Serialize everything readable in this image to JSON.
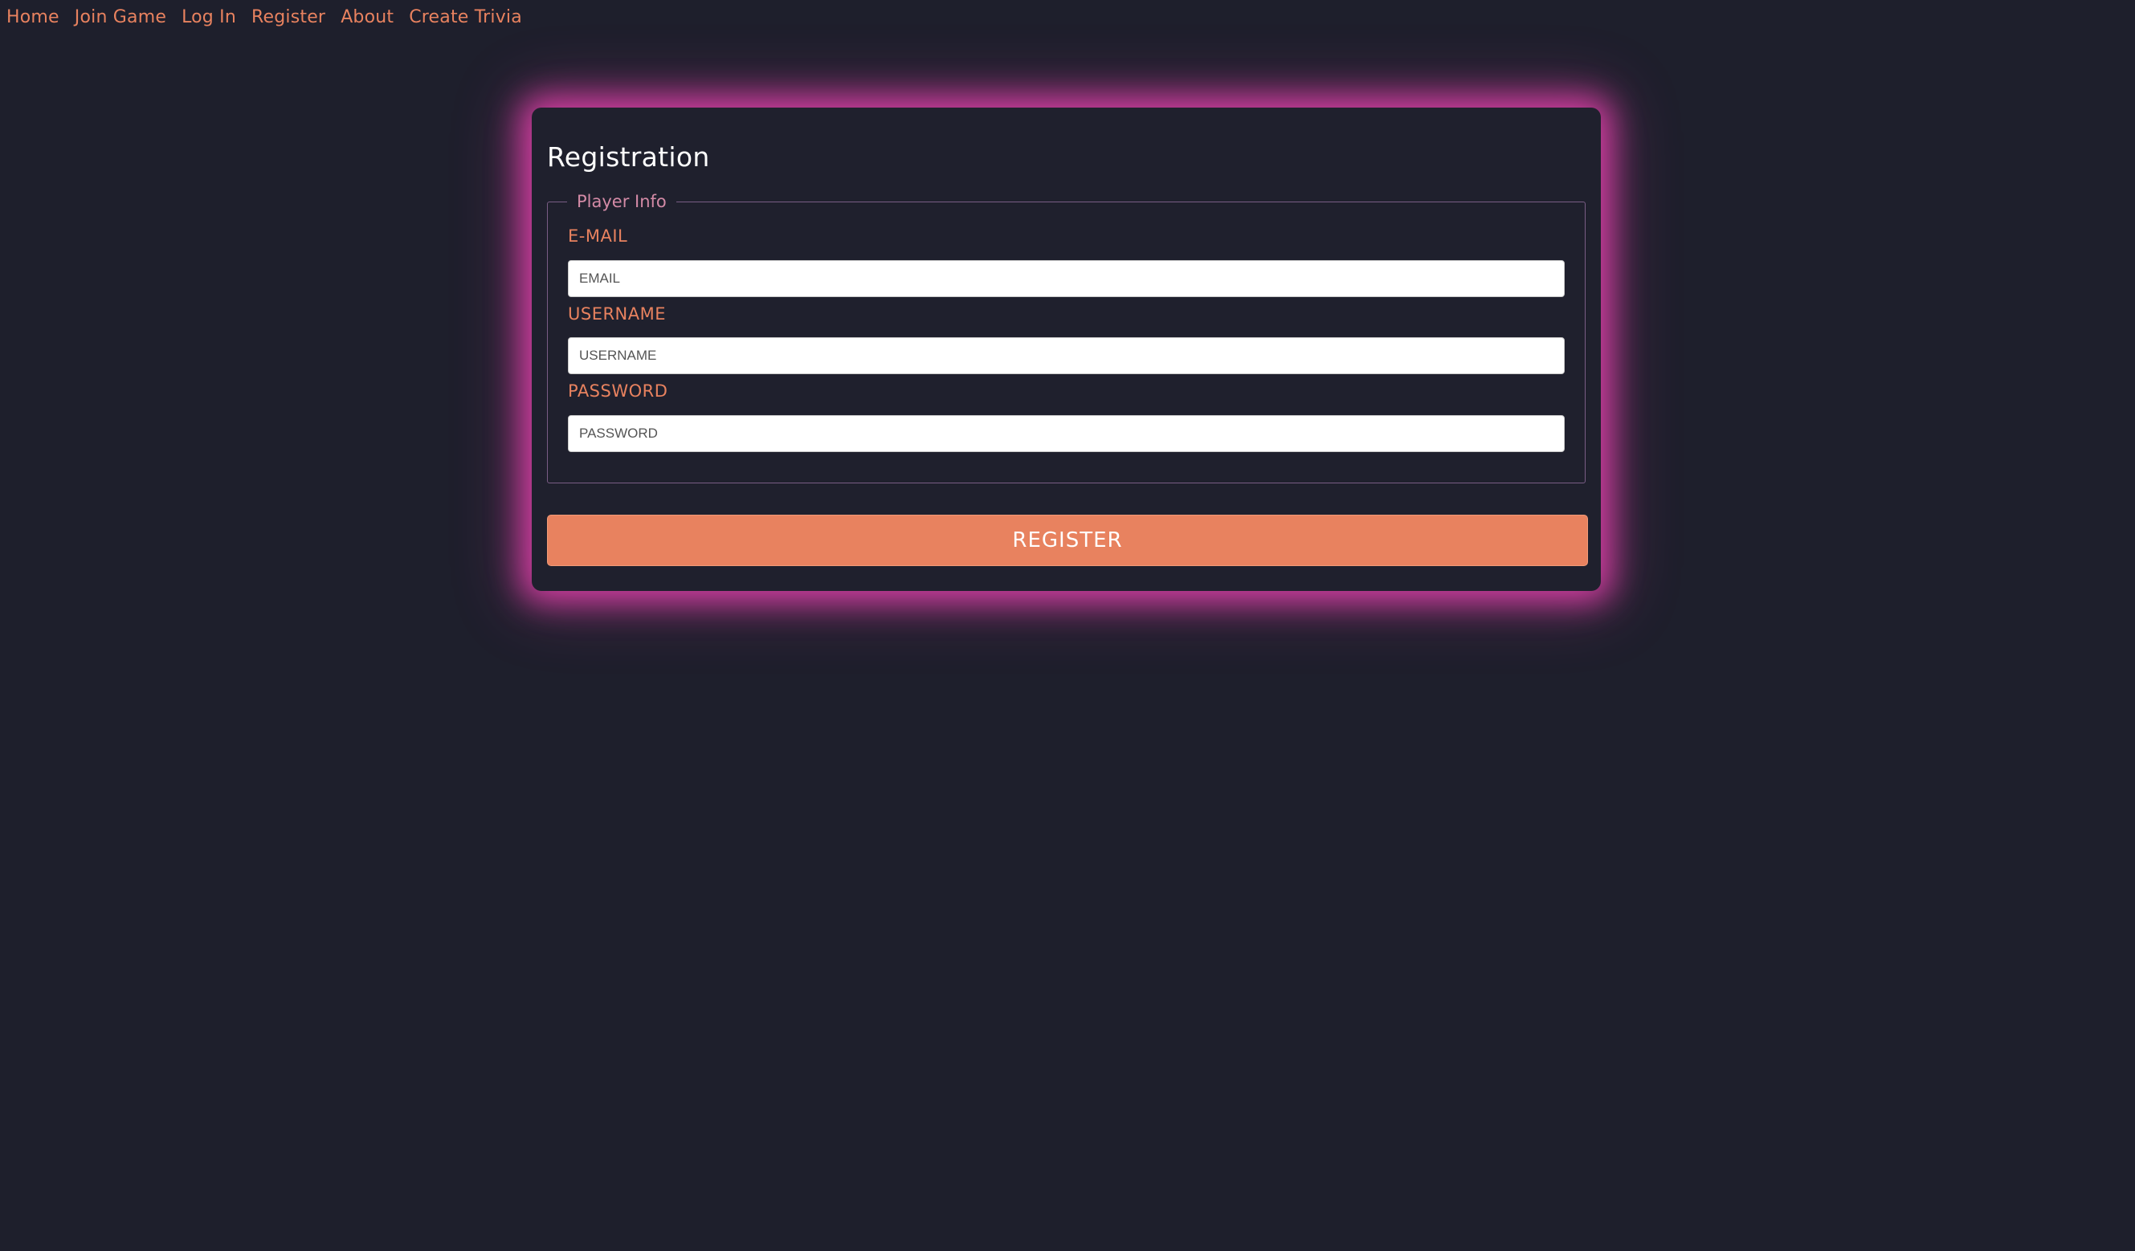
{
  "nav": {
    "items": [
      {
        "label": "Home"
      },
      {
        "label": "Join Game"
      },
      {
        "label": "Log In"
      },
      {
        "label": "Register"
      },
      {
        "label": "About"
      },
      {
        "label": "Create Trivia"
      }
    ]
  },
  "form": {
    "title": "Registration",
    "legend": "Player Info",
    "fields": [
      {
        "label": "E-MAIL",
        "placeholder": "EMAIL",
        "value": ""
      },
      {
        "label": "USERNAME",
        "placeholder": "USERNAME",
        "value": ""
      },
      {
        "label": "PASSWORD",
        "placeholder": "PASSWORD",
        "value": ""
      }
    ],
    "submit_label": "REGISTER"
  },
  "colors": {
    "background": "#1e1f2c",
    "accent": "#e8825f",
    "glow": "#ff46be",
    "legend": "#d38aa6"
  }
}
